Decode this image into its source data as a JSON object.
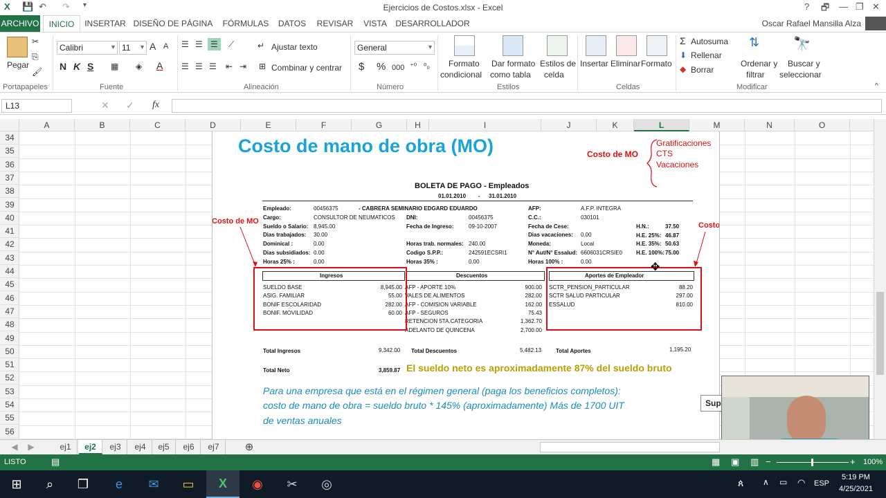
{
  "window": {
    "title": "Ejercicios de Costos.xlsx - Excel",
    "user": "Oscar Rafael Mansilla Alza",
    "help": "?",
    "restore": "🗗",
    "minimize": "—",
    "maximize": "❐",
    "close": "✕"
  },
  "tabs": {
    "file": "ARCHIVO",
    "home": "INICIO",
    "insert": "INSERTAR",
    "layout": "DISEÑO DE PÁGINA",
    "formulas": "FÓRMULAS",
    "data": "DATOS",
    "review": "REVISAR",
    "view": "VISTA",
    "developer": "DESARROLLADOR"
  },
  "ribbon": {
    "paste": "Pegar",
    "clipboard": "Portapapeles",
    "font_name": "Calibri",
    "font_size": "11",
    "grow": "A",
    "shrink": "A",
    "bold": "N",
    "italic": "K",
    "underline": "S",
    "font_group": "Fuente",
    "wrap_text": "Ajustar texto",
    "merge_center": "Combinar y centrar",
    "alignment_group": "Alineación",
    "number_format": "General",
    "currency": "$",
    "percent": "%",
    "thousands": "000",
    "number_group": "Número",
    "cond_format_1": "Formato",
    "cond_format_2": "condicional",
    "table_format_1": "Dar formato",
    "table_format_2": "como tabla",
    "cell_styles_1": "Estilos de",
    "cell_styles_2": "celda",
    "styles_group": "Estilos",
    "insert": "Insertar",
    "delete": "Eliminar",
    "format": "Formato",
    "cells_group": "Celdas",
    "autosum": "Autosuma",
    "fill": "Rellenar",
    "clear": "Borrar",
    "sort_1": "Ordenar y",
    "sort_2": "filtrar",
    "find_1": "Buscar y",
    "find_2": "seleccionar",
    "edit_group": "Modificar"
  },
  "formula_bar": {
    "name_box": "L13",
    "fx": "fx",
    "value": ""
  },
  "columns": [
    "A",
    "B",
    "C",
    "D",
    "E",
    "F",
    "G",
    "H",
    "I",
    "J",
    "K",
    "L",
    "M",
    "N",
    "O"
  ],
  "rows": [
    "34",
    "35",
    "36",
    "37",
    "38",
    "39",
    "40",
    "41",
    "42",
    "43",
    "44",
    "45",
    "46",
    "47",
    "48",
    "49",
    "50",
    "51",
    "52",
    "53",
    "54",
    "55",
    "56"
  ],
  "sheets": [
    "ej1",
    "ej2",
    "ej3",
    "ej4",
    "ej5",
    "ej6",
    "ej7"
  ],
  "active_sheet": "ej2",
  "status": {
    "mode": "LISTO",
    "zoom": "100%"
  },
  "taskbar": {
    "language": "ESP",
    "time": "5:19 PM",
    "date": "4/25/2021"
  },
  "picture": {
    "heading": "Costo de mano de obra (MO)",
    "cost_mo": "Costo de MO",
    "benefits": [
      "Gratificaciones",
      "CTS",
      "Vacaciones"
    ],
    "slip_title": "BOLETA DE PAGO -   Empleados",
    "period_start": "01.01.2010",
    "period_sep": "-",
    "period_end": "31.01.2010",
    "info": [
      {
        "l": "Empleado:",
        "v": "00456375",
        "x": "- CABRERA SEMINARIO EDGARD EDUARDO"
      },
      {
        "l": "Cargo:",
        "v": "CONSULTOR DE NEUMATICOS"
      },
      {
        "l": "Sueldo o Salario:",
        "v": "8,945.00"
      },
      {
        "l": "Dias trabajados:",
        "v": "30.00"
      },
      {
        "l": "Dominical :",
        "v": "0.00"
      },
      {
        "l": "Dias subsidiados:",
        "v": "0.00"
      },
      {
        "l": "Horas 25% :",
        "v": "0.00"
      }
    ],
    "info_mid": [
      {
        "l": "DNI:",
        "v": "00456375"
      },
      {
        "l": "Fecha de Ingreso:",
        "v": "09-10-2007"
      },
      {
        "l": "Horas trab. normales:",
        "v": "240.00"
      },
      {
        "l": "Codigo S.P.P.:",
        "v": "242591ECSRI1"
      },
      {
        "l": "Horas 35% :",
        "v": "0.00"
      }
    ],
    "info_right": [
      {
        "l": "AFP:",
        "v": "A.F.P. INTEGRA"
      },
      {
        "l": "C.C.:",
        "v": "030101"
      },
      {
        "l": "Fecha de Cese:",
        "v": ""
      },
      {
        "l": "Dias vacaciones:",
        "v": "0.00"
      },
      {
        "l": "Moneda:",
        "v": "Local"
      },
      {
        "l": "N° Aut/N° Essalud:",
        "v": "6606031CRSIE0"
      },
      {
        "l": "Horas 100% :",
        "v": "0.00"
      }
    ],
    "info_far": [
      {
        "l": "H.N.:",
        "v": "37.50"
      },
      {
        "l": "H.E. 25%:",
        "v": "46.87"
      },
      {
        "l": "H.E. 35%:",
        "v": "50.63"
      },
      {
        "l": "H.E. 100%:",
        "v": "75.00"
      }
    ],
    "ingresos_title": "Ingresos",
    "ingresos": [
      {
        "l": "SUELDO BASE",
        "v": "8,945.00"
      },
      {
        "l": "ASIG. FAMILIAR",
        "v": "55.00"
      },
      {
        "l": "BONIF ESCOLARIDAD",
        "v": "282.00"
      },
      {
        "l": "BONIF. MOVILIDAD",
        "v": "60.00"
      }
    ],
    "descuentos_title": "Descuentos",
    "descuentos": [
      {
        "l": "AFP - APORTE 10%",
        "v": "900.00"
      },
      {
        "l": "VALES DE ALIMENTOS",
        "v": "282.00"
      },
      {
        "l": "AFP - COMISION VARIABLE",
        "v": "162.00"
      },
      {
        "l": "AFP - SEGUROS",
        "v": "75.43"
      },
      {
        "l": "RETENCION 5TA.CATEGORIA",
        "v": "1,362.70"
      },
      {
        "l": "ADELANTO DE QUINCENA",
        "v": "2,700.00"
      }
    ],
    "aportes_title": "Aportes de Empleador",
    "aportes": [
      {
        "l": "SCTR_PENSION_PARTICULAR",
        "v": "88.20"
      },
      {
        "l": "SCTR SALUD PARTICULAR",
        "v": "297.00"
      },
      {
        "l": "ESSALUD",
        "v": "810.00"
      }
    ],
    "total_ingresos_l": "Total Ingresos",
    "total_ingresos_v": "9,342.00",
    "total_descuentos_l": "Total Descuentos",
    "total_descuentos_v": "5,482.13",
    "total_aportes_l": "Total Aportes",
    "total_aportes_v": "1,195.20",
    "total_neto_l": "Total Neto",
    "total_neto_v": "3,859.87",
    "net_note": "El sueldo neto es aproximadamente 87% del sueldo bruto",
    "footer_1": "Para una empresa que está en el régimen general (paga los beneficios completos):",
    "footer_2": "costo de mano de obra = sueldo bruto * 145% (aproximadamente) Más de 1700 UIT",
    "footer_3": "de ventas anuales"
  },
  "sup_label": "Sup",
  "colors": {
    "excel_green": "#217346",
    "heading_blue": "#1aa3d9",
    "red": "#e01010",
    "olive": "#b8a000"
  }
}
